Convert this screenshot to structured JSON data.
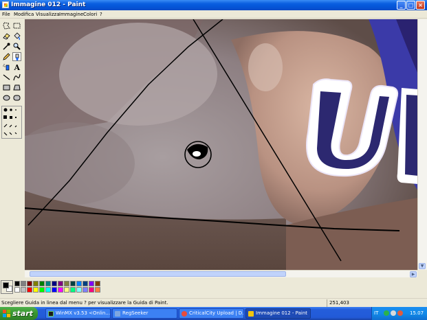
{
  "window": {
    "title": "Immagine 012 - Paint",
    "controls": {
      "minimize": "_",
      "maximize": "□",
      "close": "×"
    }
  },
  "menu": [
    "File",
    "Modifica",
    "Visualizza",
    "Immagine",
    "Colori",
    "?"
  ],
  "toolbox": {
    "tools": [
      {
        "name": "free-select-icon"
      },
      {
        "name": "rect-select-icon"
      },
      {
        "name": "eraser-icon"
      },
      {
        "name": "fill-icon"
      },
      {
        "name": "color-picker-icon"
      },
      {
        "name": "magnifier-icon"
      },
      {
        "name": "pencil-icon"
      },
      {
        "name": "brush-icon"
      },
      {
        "name": "airbrush-icon"
      },
      {
        "name": "text-icon",
        "glyph": "A"
      },
      {
        "name": "line-icon"
      },
      {
        "name": "curve-icon"
      },
      {
        "name": "rectangle-icon"
      },
      {
        "name": "polygon-icon"
      },
      {
        "name": "ellipse-icon"
      },
      {
        "name": "rounded-rect-icon"
      }
    ],
    "selected": "brush-icon"
  },
  "palette": {
    "foreground": "#000000",
    "background": "#ffffff",
    "colors": [
      "#000000",
      "#808080",
      "#800000",
      "#808000",
      "#008000",
      "#008080",
      "#000080",
      "#800080",
      "#808040",
      "#004040",
      "#0080ff",
      "#004080",
      "#8000ff",
      "#804000",
      "#ffffff",
      "#c0c0c0",
      "#ff0000",
      "#ffff00",
      "#00ff00",
      "#00ffff",
      "#0000ff",
      "#ff00ff",
      "#ffff80",
      "#00ff80",
      "#80ffff",
      "#8080ff",
      "#ff0080",
      "#ff8040"
    ]
  },
  "status": {
    "help_text": "Scegliere Guida in linea dal menu ? per visualizzare la Guida di Paint.",
    "coords": "251,403"
  },
  "taskbar": {
    "start_label": "start",
    "tasks": [
      {
        "label": "WinMX v3.53  <Onlin...",
        "icon_color": "#1b1b1b",
        "active": false
      },
      {
        "label": "RegSeeker",
        "icon_color": "#7fa7e0",
        "active": false
      },
      {
        "label": "CriticalCity Upload | D...",
        "icon_color": "#e74c3c",
        "active": false
      },
      {
        "label": "Immagine 012 - Paint",
        "icon_color": "#f1c40f",
        "active": true
      }
    ],
    "language": "IT",
    "clock": "15.07"
  }
}
